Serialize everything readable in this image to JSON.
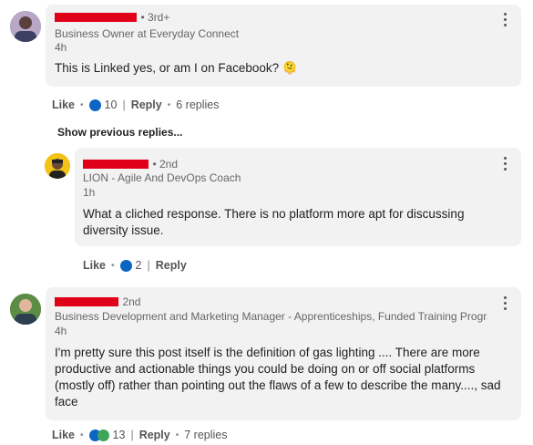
{
  "comments": [
    {
      "degree": "• 3rd+",
      "subtitle": "Business Owner at Everyday Connect",
      "time": "4h",
      "text": "This is Linked yes, or am I on Facebook? 🫠",
      "actions": {
        "like": "Like",
        "reaction_count": "10",
        "reply": "Reply",
        "replies": "6 replies"
      }
    },
    {
      "degree": "• 2nd",
      "subtitle": "LION - Agile And DevOps Coach",
      "time": "1h",
      "text": "What a cliched response. There is no platform more apt for discussing diversity issue.",
      "actions": {
        "like": "Like",
        "reaction_count": "2",
        "reply": "Reply"
      }
    },
    {
      "degree": "2nd",
      "subtitle": "Business Development and Marketing Manager - Apprenticeships, Funded Training Progra...",
      "time": "4h",
      "text": "I'm pretty sure this post itself is the definition of gas lighting .... There are more productive and actionable things you could be doing on or off social platforms (mostly off) rather than pointing out the flaws of a few to describe the many...., sad face",
      "actions": {
        "like": "Like",
        "reaction_count": "13",
        "reply": "Reply",
        "replies": "7 replies"
      }
    }
  ],
  "show_previous": "Show previous replies...",
  "colors": {
    "redaction": "#e1001a",
    "like_blue": "#0a66c2",
    "bubble_bg": "#f2f2f2"
  }
}
